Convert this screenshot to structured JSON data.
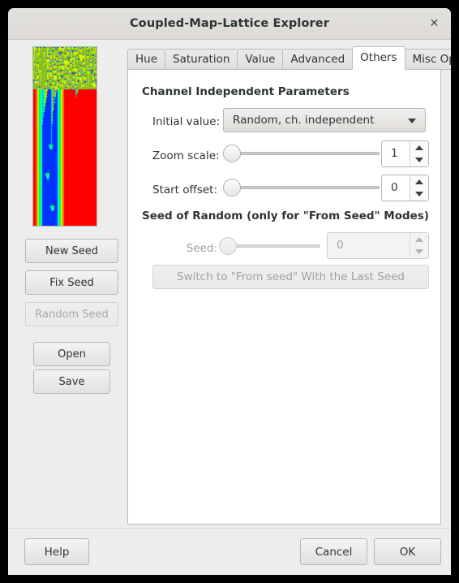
{
  "window": {
    "title": "Coupled-Map-Lattice Explorer",
    "close_icon": "close-icon",
    "close_glyph": "✕"
  },
  "preview": {
    "name": "lattice-preview",
    "description": "Coupled map lattice spacetime plot"
  },
  "sidebar": {
    "buttons": [
      {
        "label": "New Seed",
        "enabled": true
      },
      {
        "label": "Fix Seed",
        "enabled": true
      },
      {
        "label": "Random Seed",
        "enabled": false
      },
      {
        "label": "Open",
        "enabled": true
      },
      {
        "label": "Save",
        "enabled": true
      }
    ]
  },
  "tabs": [
    {
      "label": "Hue",
      "active": false
    },
    {
      "label": "Saturation",
      "active": false
    },
    {
      "label": "Value",
      "active": false
    },
    {
      "label": "Advanced",
      "active": false
    },
    {
      "label": "Others",
      "active": true
    },
    {
      "label": "Misc Ops.",
      "active": false
    }
  ],
  "others_page": {
    "group_channel_title": "Channel Independent Parameters",
    "group_seed_title": "Seed of Random (only for \"From Seed\" Modes)",
    "initial_value": {
      "label": "Initial value:",
      "selected": "Random, ch. independent",
      "arrow_icon": "chevron-down-icon"
    },
    "zoom_scale": {
      "label": "Zoom scale:",
      "value": "1",
      "slider_position_pct": 0
    },
    "start_offset": {
      "label": "Start offset:",
      "value": "0",
      "slider_position_pct": 0
    },
    "seed": {
      "label": "Seed:",
      "value": "0",
      "slider_position_pct": 0,
      "enabled": false
    },
    "switch_button": {
      "label": "Switch to \"From seed\" With the Last Seed",
      "enabled": false
    }
  },
  "actions": {
    "help": "Help",
    "cancel": "Cancel",
    "ok": "OK"
  },
  "colors": {
    "window_bg": "#ededed",
    "titlebar_bg": "#e0dedb",
    "panel_bg": "#ffffff",
    "text": "#2e3436",
    "disabled_text": "#a0a0a0",
    "border": "#bdbab7"
  }
}
